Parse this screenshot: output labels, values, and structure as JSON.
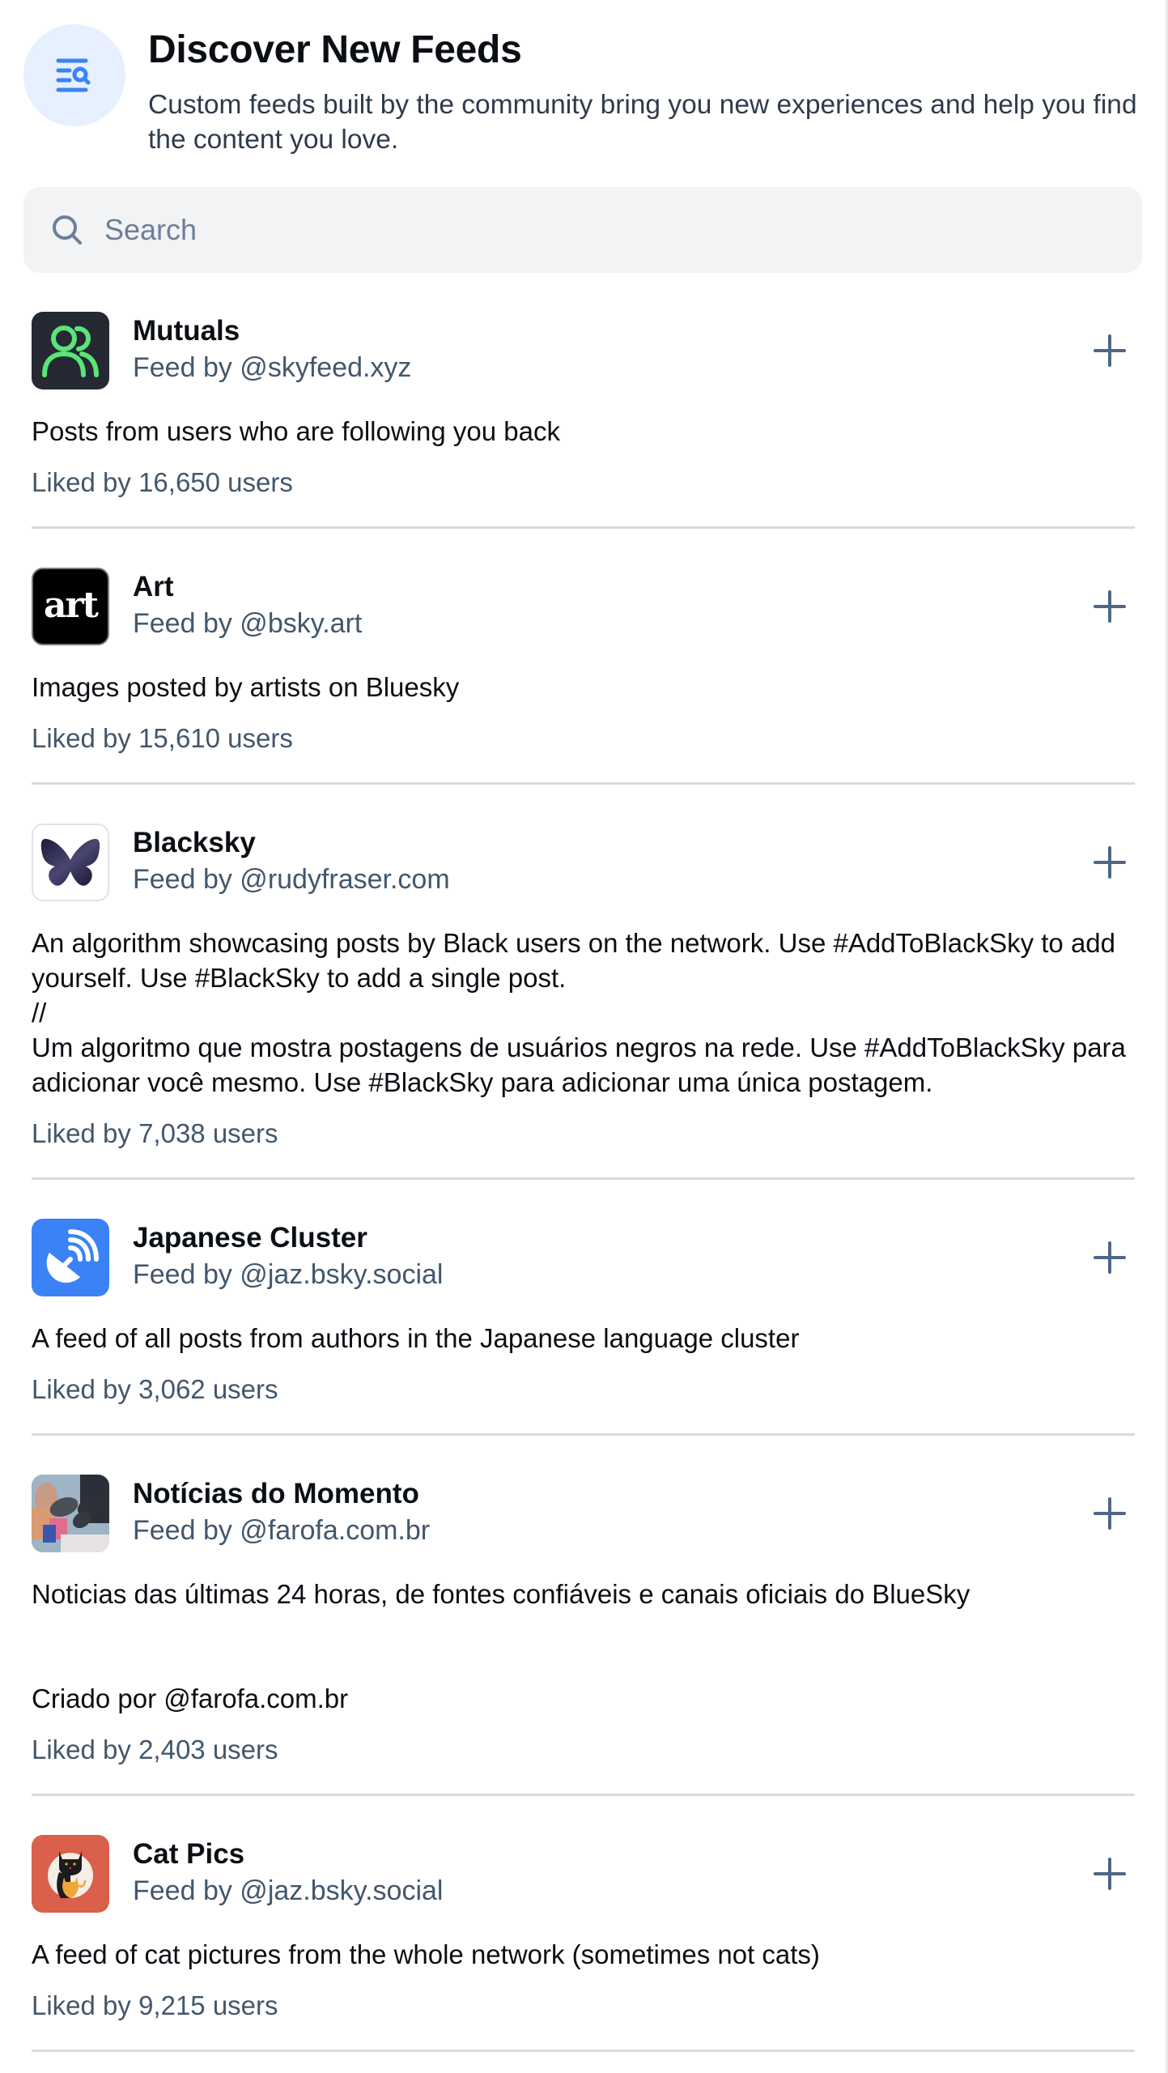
{
  "header": {
    "icon": "feed-search-icon",
    "title": "Discover New Feeds",
    "subtitle": "Custom feeds built by the community bring you new experiences and help you find the content you love."
  },
  "search": {
    "icon": "search-icon",
    "placeholder": "Search",
    "value": ""
  },
  "colors": {
    "accent": "#3b82f6",
    "accent_bg": "#e6f0fe",
    "muted_text": "#42576c",
    "divider": "#d4dbe2",
    "search_bg": "#f1f3f5"
  },
  "feeds": [
    {
      "title": "Mutuals",
      "handle": "Feed by @skyfeed.xyz",
      "avatar": "mutuals-people-icon",
      "description": "Posts from users who are following you back",
      "likes": "Liked by 16,650 users",
      "action": "add-icon"
    },
    {
      "title": "Art",
      "handle": "Feed by @bsky.art",
      "avatar": "art-logo",
      "avatar_text": "art",
      "description": "Images posted by artists on Bluesky",
      "likes": "Liked by 15,610 users",
      "action": "add-icon"
    },
    {
      "title": "Blacksky",
      "handle": "Feed by @rudyfraser.com",
      "avatar": "butterfly-logo",
      "description": "An algorithm showcasing posts by Black users on the network. Use #AddToBlackSky to add yourself. Use #BlackSky to add a single post.\n//\nUm algoritmo que mostra postagens de usuários negros na rede. Use #AddToBlackSky para adicionar você mesmo. Use #BlackSky para adicionar uma única postagem.",
      "likes": "Liked by 7,038 users",
      "action": "add-icon"
    },
    {
      "title": "Japanese Cluster",
      "handle": "Feed by @jaz.bsky.social",
      "avatar": "satellite-dish-icon",
      "description": "A feed of all posts from authors in the Japanese language cluster",
      "likes": "Liked by 3,062 users",
      "action": "add-icon"
    },
    {
      "title": "Notícias do Momento",
      "handle": "Feed by @farofa.com.br",
      "avatar": "press-microphones-photo",
      "description": "Noticias das últimas 24 horas, de fontes confiáveis  e canais oficiais do BlueSky\n \n \nCriado por @farofa.com.br",
      "likes": "Liked by 2,403 users",
      "action": "add-icon"
    },
    {
      "title": "Cat Pics",
      "handle": "Feed by @jaz.bsky.social",
      "avatar": "cats-logo",
      "description": "A feed of cat pictures from the whole network (sometimes not cats)",
      "likes": "Liked by 9,215 users",
      "action": "add-icon"
    }
  ]
}
